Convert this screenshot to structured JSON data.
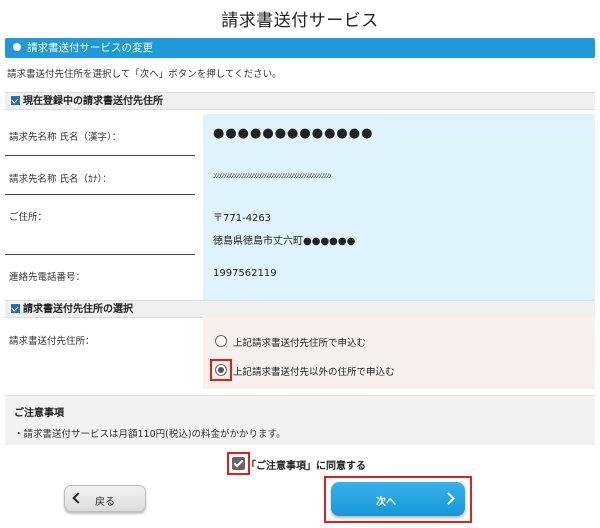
{
  "page": {
    "title": "請求書送付サービス"
  },
  "section": {
    "title": "請求書送付サービスの変更"
  },
  "instruction": "請求書送付先住所を選択して「次へ」ボタンを押してください。",
  "current": {
    "heading": "現在登録中の請求書送付先住所",
    "name_kanji_label": "請求先名称 氏名（漢字）：",
    "name_kanji_value": "●●●●●●●●●●●●●",
    "name_kana_label": "請求先名称 氏名（ｶﾅ）：",
    "name_kana_value": "ﾝﾝﾝﾝﾝﾝﾝﾝﾝﾝﾝﾝﾝﾝﾝﾝﾝﾝﾝﾝﾝﾝﾝﾝﾝﾝﾝﾝﾝﾝﾝﾝﾝﾝﾝﾝﾝﾝﾝﾝﾝﾝﾝﾝﾝﾝﾝ",
    "address_label": "ご住所：",
    "postal_code": "〒771-4263",
    "address_value": "徳島県徳島市丈六町●●●●●●",
    "phone_label": "連絡先電話番号：",
    "phone_value": "1997562119"
  },
  "selection": {
    "heading": "請求書送付先住所の選択",
    "label": "請求書送付先住所：",
    "option_same": "上記請求書送付先住所で申込む",
    "option_other": "上記請求書送付先以外の住所で申込む",
    "selected": "option_other"
  },
  "notes": {
    "title": "ご注意事項",
    "body": "・請求書送付サービスは月額110円(税込)の料金がかかります。"
  },
  "agree": {
    "label": "「ご注意事項」に同意する",
    "checked": true
  },
  "buttons": {
    "back": "戻る",
    "next": "次へ"
  },
  "colors": {
    "accent": "#1f9ad9",
    "highlight": "#e02020",
    "value_bg": "#dff3fc"
  }
}
